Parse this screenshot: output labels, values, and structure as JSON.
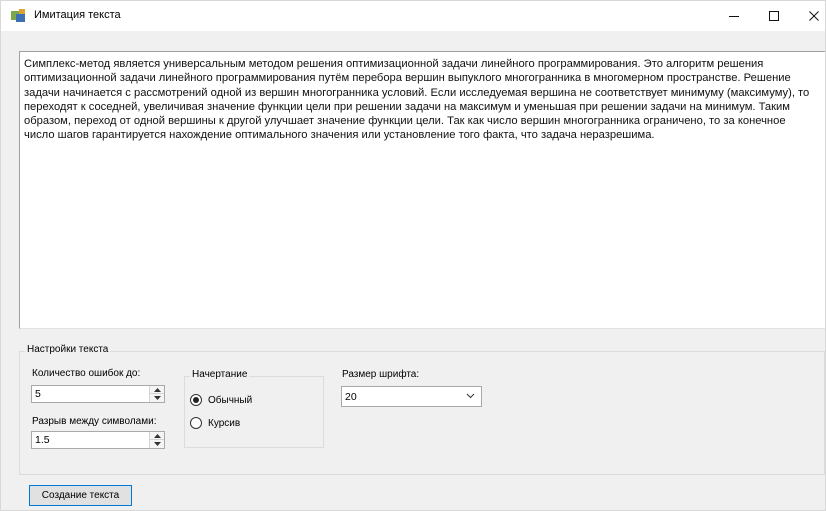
{
  "window": {
    "title": "Имитация текста",
    "controls": {
      "minimize_icon": "minimize-icon",
      "maximize_icon": "maximize-icon",
      "close_icon": "close-icon"
    }
  },
  "text_area": {
    "content": "Симплекс-метод является универсальным методом решения оптимизационной задачи линейного программирования. Это алгоритм решения оптимизационной задачи линейного программирования путём перебора вершин выпуклого многогранника в многомерном пространстве. Решение задачи начинается с рассмотрений одной из вершин многогранника условий. Если исследуемая вершина не соответствует минимуму (максимуму), то переходят к соседней, увеличивая значение функции цели при решении задачи на максимум и уменьшая при решении задачи на минимум. Таким образом, переход от одной вершины к другой улучшает значение функции цели. Так как число вершин многогранника ограничено, то за конечное число шагов гарантируется нахождение оптимального значения или установление того факта, что задача неразрешима."
  },
  "settings": {
    "group_title": "Настройки текста",
    "errors": {
      "label": "Количество ошибок до:",
      "value": "5"
    },
    "spacing": {
      "label": "Разрыв между символами:",
      "value": "1.5"
    },
    "style": {
      "group_title": "Начертание",
      "options": [
        {
          "label": "Обычный",
          "checked": true
        },
        {
          "label": "Курсив",
          "checked": false
        }
      ]
    },
    "font_size": {
      "label": "Размер шрифта:",
      "value": "20"
    }
  },
  "actions": {
    "create_label": "Создание текста"
  }
}
